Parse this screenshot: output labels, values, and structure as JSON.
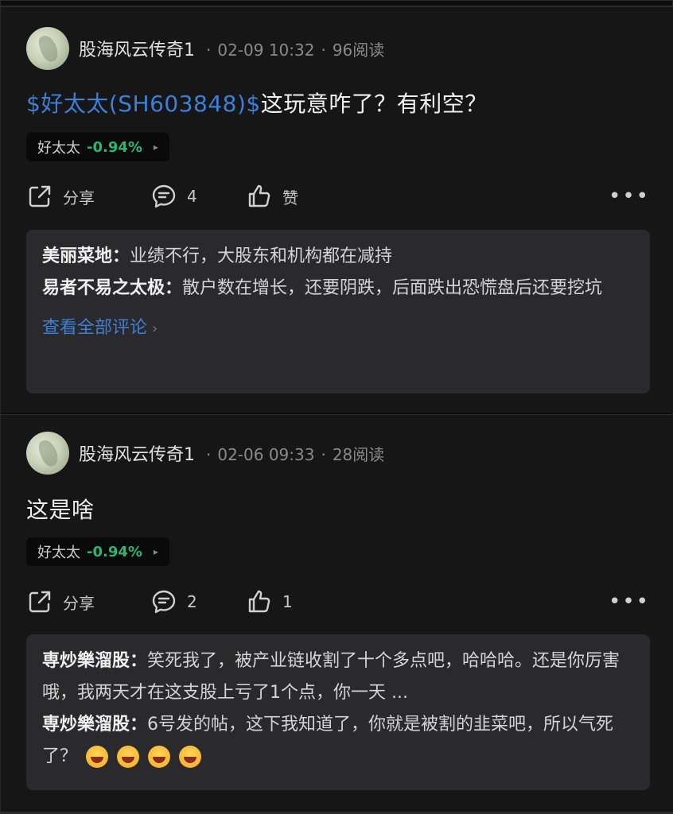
{
  "posts": [
    {
      "author": "股海风云传奇1",
      "sep": "·",
      "date": "02-09 10:32",
      "reads": "96阅读",
      "content_tag": "$好太太(SH603848)$",
      "content_text": "这玩意咋了？有利空？",
      "stock": {
        "name": "好太太",
        "change": "-0.94%",
        "arrow": "▸"
      },
      "actions": {
        "share": "分享",
        "comments": "4",
        "like": "赞",
        "more": "•••"
      },
      "comments": [
        {
          "name": "美丽菜地：",
          "text": "业绩不行，大股东和机构都在减持"
        },
        {
          "name": "易者不易之太极：",
          "text": "散户数在增长，还要阴跌，后面跌出恐慌盘后还要挖坑"
        }
      ],
      "view_all": "查看全部评论",
      "view_all_chev": "›"
    },
    {
      "author": "股海风云传奇1",
      "sep": "·",
      "date": "02-06 09:33",
      "reads": "28阅读",
      "content_text": "这是啥",
      "stock": {
        "name": "好太太",
        "change": "-0.94%",
        "arrow": "▸"
      },
      "actions": {
        "share": "分享",
        "comments": "2",
        "like": "1",
        "more": "•••"
      },
      "comments": [
        {
          "name": "専炒樂溜股：",
          "text": "笑死我了，被产业链收割了十个多点吧，哈哈哈。还是你厉害哦，我两天才在这支股上亏了1个点，你一天 ..."
        },
        {
          "name": "専炒樂溜股：",
          "text": "6号发的帖，这下我知道了，你就是被割的韭菜吧，所以气死了？"
        }
      ]
    }
  ],
  "icons": {
    "share": "share-icon",
    "comment": "comment-icon",
    "like": "thumbs-up-icon",
    "more": "more-icon",
    "emoji": "grinning-emoji-icon"
  },
  "colors": {
    "link": "#3d7fd6",
    "negative_change": "#2bb673",
    "card_bg": "#2a2a2c",
    "post_bg": "#161616"
  }
}
